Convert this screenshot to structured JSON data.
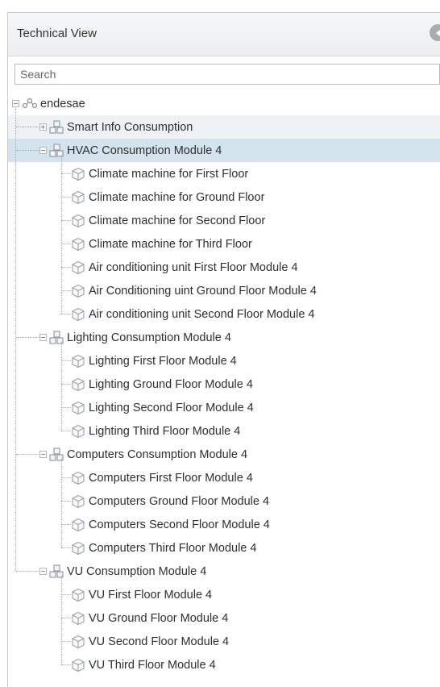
{
  "panel": {
    "title": "Technical View",
    "search_placeholder": "Search"
  },
  "tree": {
    "root": "endesae",
    "groups": [
      {
        "label": "Smart Info Consumption",
        "expanded": false,
        "children": []
      },
      {
        "label": "HVAC Consumption Module 4",
        "expanded": true,
        "selected": true,
        "children": [
          "Climate machine for First Floor",
          "Climate machine for Ground Floor",
          "Climate machine for Second Floor",
          "Climate machine for Third Floor",
          "Air conditioning unit First Floor Module 4",
          "Air Conditioning uint Ground Floor Module 4",
          "Air conditioning unit Second Floor Module 4"
        ]
      },
      {
        "label": "Lighting Consumption Module 4",
        "expanded": true,
        "children": [
          "Lighting First Floor Module 4",
          "Lighting Ground Floor Module 4",
          "Lighting Second Floor Module 4",
          "Lighting Third Floor Module 4"
        ]
      },
      {
        "label": "Computers Consumption Module 4",
        "expanded": true,
        "children": [
          "Computers First Floor Module 4",
          "Computers Ground Floor Module 4",
          "Computers Second Floor Module 4",
          "Computers Third Floor Module 4"
        ]
      },
      {
        "label": "VU Consumption Module 4",
        "expanded": true,
        "children": [
          "VU First Floor Module 4",
          "VU Ground Floor Module 4",
          "VU Second Floor Module 4",
          "VU Third Floor Module 4"
        ]
      }
    ]
  },
  "colors": {
    "selected_row": "#d4e4ef",
    "hover_row": "#eef2f5",
    "icon": "#9aa3ab"
  }
}
